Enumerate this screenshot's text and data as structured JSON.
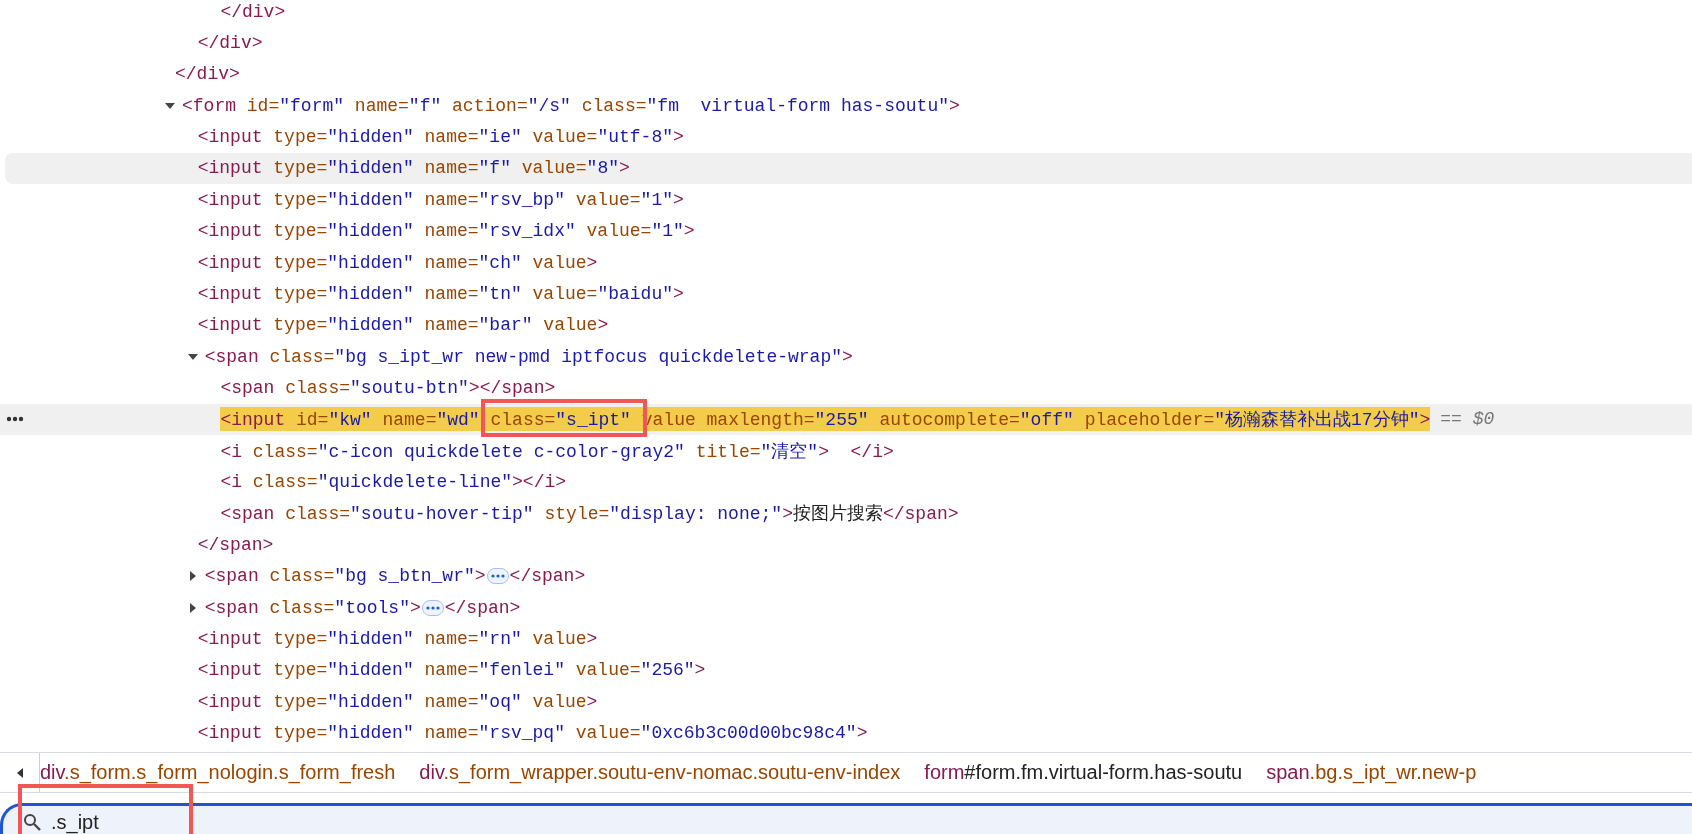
{
  "dom_tree": [
    {
      "selected": false,
      "hovered": false,
      "close": [
        {
          "kind": "tag",
          "text": "</div>"
        }
      ],
      "children": [
        {
          "selected": false,
          "hovered": false,
          "close": [
            {
              "kind": "tag",
              "text": "</div>"
            }
          ],
          "children": [
            {
              "selected": false,
              "hovered": false,
              "close": [
                {
                  "kind": "tag",
                  "text": "</div>"
                }
              ]
            }
          ]
        }
      ]
    },
    {
      "selected": false,
      "hovered": false,
      "expanded": true,
      "open": [
        {
          "kind": "tag",
          "text": "<form"
        },
        {
          "kind": "attr",
          "text": " id="
        },
        {
          "kind": "value",
          "text": "\"form\""
        },
        {
          "kind": "attr",
          "text": " name="
        },
        {
          "kind": "value",
          "text": "\"f\""
        },
        {
          "kind": "attr",
          "text": " action="
        },
        {
          "kind": "value",
          "text": "\"/s\""
        },
        {
          "kind": "attr",
          "text": " class="
        },
        {
          "kind": "value",
          "text": "\"fm  virtual-form has-soutu\""
        },
        {
          "kind": "tag",
          "text": ">"
        }
      ],
      "children": [
        {
          "selected": false,
          "hovered": false,
          "open": [
            {
              "kind": "tag",
              "text": "<input"
            },
            {
              "kind": "attr",
              "text": " type="
            },
            {
              "kind": "value",
              "text": "\"hidden\""
            },
            {
              "kind": "attr",
              "text": " name="
            },
            {
              "kind": "value",
              "text": "\"ie\""
            },
            {
              "kind": "attr",
              "text": " value="
            },
            {
              "kind": "value",
              "text": "\"utf-8\""
            },
            {
              "kind": "tag",
              "text": ">"
            }
          ]
        },
        {
          "selected": false,
          "hovered": true,
          "open": [
            {
              "kind": "tag",
              "text": "<input"
            },
            {
              "kind": "attr",
              "text": " type="
            },
            {
              "kind": "value",
              "text": "\"hidden\""
            },
            {
              "kind": "attr",
              "text": " name="
            },
            {
              "kind": "value",
              "text": "\"f\""
            },
            {
              "kind": "attr",
              "text": " value="
            },
            {
              "kind": "value",
              "text": "\"8\""
            },
            {
              "kind": "tag",
              "text": ">"
            }
          ]
        },
        {
          "selected": false,
          "hovered": false,
          "open": [
            {
              "kind": "tag",
              "text": "<input"
            },
            {
              "kind": "attr",
              "text": " type="
            },
            {
              "kind": "value",
              "text": "\"hidden\""
            },
            {
              "kind": "attr",
              "text": " name="
            },
            {
              "kind": "value",
              "text": "\"rsv_bp\""
            },
            {
              "kind": "attr",
              "text": " value="
            },
            {
              "kind": "value",
              "text": "\"1\""
            },
            {
              "kind": "tag",
              "text": ">"
            }
          ]
        },
        {
          "selected": false,
          "hovered": false,
          "open": [
            {
              "kind": "tag",
              "text": "<input"
            },
            {
              "kind": "attr",
              "text": " type="
            },
            {
              "kind": "value",
              "text": "\"hidden\""
            },
            {
              "kind": "attr",
              "text": " name="
            },
            {
              "kind": "value",
              "text": "\"rsv_idx\""
            },
            {
              "kind": "attr",
              "text": " value="
            },
            {
              "kind": "value",
              "text": "\"1\""
            },
            {
              "kind": "tag",
              "text": ">"
            }
          ]
        },
        {
          "selected": false,
          "hovered": false,
          "open": [
            {
              "kind": "tag",
              "text": "<input"
            },
            {
              "kind": "attr",
              "text": " type="
            },
            {
              "kind": "value",
              "text": "\"hidden\""
            },
            {
              "kind": "attr",
              "text": " name="
            },
            {
              "kind": "value",
              "text": "\"ch\""
            },
            {
              "kind": "attr",
              "text": " value"
            },
            {
              "kind": "tag",
              "text": ">"
            }
          ]
        },
        {
          "selected": false,
          "hovered": false,
          "open": [
            {
              "kind": "tag",
              "text": "<input"
            },
            {
              "kind": "attr",
              "text": " type="
            },
            {
              "kind": "value",
              "text": "\"hidden\""
            },
            {
              "kind": "attr",
              "text": " name="
            },
            {
              "kind": "value",
              "text": "\"tn\""
            },
            {
              "kind": "attr",
              "text": " value="
            },
            {
              "kind": "value",
              "text": "\"baidu\""
            },
            {
              "kind": "tag",
              "text": ">"
            }
          ]
        },
        {
          "selected": false,
          "hovered": false,
          "open": [
            {
              "kind": "tag",
              "text": "<input"
            },
            {
              "kind": "attr",
              "text": " type="
            },
            {
              "kind": "value",
              "text": "\"hidden\""
            },
            {
              "kind": "attr",
              "text": " name="
            },
            {
              "kind": "value",
              "text": "\"bar\""
            },
            {
              "kind": "attr",
              "text": " value"
            },
            {
              "kind": "tag",
              "text": ">"
            }
          ]
        },
        {
          "selected": false,
          "hovered": false,
          "expanded": true,
          "open": [
            {
              "kind": "tag",
              "text": "<span"
            },
            {
              "kind": "attr",
              "text": " class="
            },
            {
              "kind": "value",
              "text": "\"bg s_ipt_wr new-pmd iptfocus quickdelete-wrap\""
            },
            {
              "kind": "tag",
              "text": ">"
            }
          ],
          "close": [
            {
              "kind": "tag",
              "text": "</span>"
            }
          ],
          "children": [
            {
              "selected": false,
              "hovered": false,
              "open": [
                {
                  "kind": "tag",
                  "text": "<span"
                },
                {
                  "kind": "attr",
                  "text": " class="
                },
                {
                  "kind": "value",
                  "text": "\"soutu-btn\""
                },
                {
                  "kind": "tag",
                  "text": "></span>"
                }
              ]
            },
            {
              "selected": true,
              "hovered": false,
              "console_ref": "== $0",
              "open": [
                {
                  "kind": "tag",
                  "text": "<input"
                },
                {
                  "kind": "attr",
                  "text": " id="
                },
                {
                  "kind": "value",
                  "text": "\"kw\""
                },
                {
                  "kind": "attr",
                  "text": " name="
                },
                {
                  "kind": "value",
                  "text": "\"wd\""
                },
                {
                  "kind": "attr",
                  "text": " class="
                },
                {
                  "kind": "value",
                  "text": "\"s_ipt\""
                },
                {
                  "kind": "attr",
                  "text": " value maxlength="
                },
                {
                  "kind": "value",
                  "text": "\"255\""
                },
                {
                  "kind": "attr",
                  "text": " autocomplete="
                },
                {
                  "kind": "value",
                  "text": "\"off\""
                },
                {
                  "kind": "attr",
                  "text": " placeholder="
                },
                {
                  "kind": "value",
                  "text": "\"杨瀚森替补出战17分钟\""
                },
                {
                  "kind": "tag",
                  "text": ">"
                }
              ]
            },
            {
              "selected": false,
              "hovered": false,
              "open": [
                {
                  "kind": "tag",
                  "text": "<i"
                },
                {
                  "kind": "attr",
                  "text": " class="
                },
                {
                  "kind": "value",
                  "text": "\"c-icon quickdelete c-color-gray2\""
                },
                {
                  "kind": "attr",
                  "text": " title="
                },
                {
                  "kind": "value",
                  "text": "\"清空\""
                },
                {
                  "kind": "tag",
                  "text": ">  </i>"
                }
              ]
            },
            {
              "selected": false,
              "hovered": false,
              "open": [
                {
                  "kind": "tag",
                  "text": "<i"
                },
                {
                  "kind": "attr",
                  "text": " class="
                },
                {
                  "kind": "value",
                  "text": "\"quickdelete-line\""
                },
                {
                  "kind": "tag",
                  "text": "></i>"
                }
              ]
            },
            {
              "selected": false,
              "hovered": false,
              "open": [
                {
                  "kind": "tag",
                  "text": "<span"
                },
                {
                  "kind": "attr",
                  "text": " class="
                },
                {
                  "kind": "value",
                  "text": "\"soutu-hover-tip\""
                },
                {
                  "kind": "attr",
                  "text": " style="
                },
                {
                  "kind": "value",
                  "text": "\"display: none;\""
                },
                {
                  "kind": "tag",
                  "text": ">"
                },
                {
                  "kind": "text",
                  "text": "按图片搜索"
                },
                {
                  "kind": "tag",
                  "text": "</span>"
                }
              ]
            }
          ]
        },
        {
          "selected": false,
          "hovered": false,
          "expanded": false,
          "open": [
            {
              "kind": "tag",
              "text": "<span"
            },
            {
              "kind": "attr",
              "text": " class="
            },
            {
              "kind": "value",
              "text": "\"bg s_btn_wr\""
            },
            {
              "kind": "tag",
              "text": ">"
            }
          ],
          "close": [
            {
              "kind": "tag",
              "text": "</span>"
            }
          ]
        },
        {
          "selected": false,
          "hovered": false,
          "expanded": false,
          "open": [
            {
              "kind": "tag",
              "text": "<span"
            },
            {
              "kind": "attr",
              "text": " class="
            },
            {
              "kind": "value",
              "text": "\"tools\""
            },
            {
              "kind": "tag",
              "text": ">"
            }
          ],
          "close": [
            {
              "kind": "tag",
              "text": "</span>"
            }
          ]
        },
        {
          "selected": false,
          "hovered": false,
          "open": [
            {
              "kind": "tag",
              "text": "<input"
            },
            {
              "kind": "attr",
              "text": " type="
            },
            {
              "kind": "value",
              "text": "\"hidden\""
            },
            {
              "kind": "attr",
              "text": " name="
            },
            {
              "kind": "value",
              "text": "\"rn\""
            },
            {
              "kind": "attr",
              "text": " value"
            },
            {
              "kind": "tag",
              "text": ">"
            }
          ]
        },
        {
          "selected": false,
          "hovered": false,
          "open": [
            {
              "kind": "tag",
              "text": "<input"
            },
            {
              "kind": "attr",
              "text": " type="
            },
            {
              "kind": "value",
              "text": "\"hidden\""
            },
            {
              "kind": "attr",
              "text": " name="
            },
            {
              "kind": "value",
              "text": "\"fenlei\""
            },
            {
              "kind": "attr",
              "text": " value="
            },
            {
              "kind": "value",
              "text": "\"256\""
            },
            {
              "kind": "tag",
              "text": ">"
            }
          ]
        },
        {
          "selected": false,
          "hovered": false,
          "open": [
            {
              "kind": "tag",
              "text": "<input"
            },
            {
              "kind": "attr",
              "text": " type="
            },
            {
              "kind": "value",
              "text": "\"hidden\""
            },
            {
              "kind": "attr",
              "text": " name="
            },
            {
              "kind": "value",
              "text": "\"oq\""
            },
            {
              "kind": "attr",
              "text": " value"
            },
            {
              "kind": "tag",
              "text": ">"
            }
          ]
        },
        {
          "selected": false,
          "hovered": false,
          "open": [
            {
              "kind": "tag",
              "text": "<input"
            },
            {
              "kind": "attr",
              "text": " type="
            },
            {
              "kind": "value",
              "text": "\"hidden\""
            },
            {
              "kind": "attr",
              "text": " name="
            },
            {
              "kind": "value",
              "text": "\"rsv_pq\""
            },
            {
              "kind": "attr",
              "text": " value="
            },
            {
              "kind": "value",
              "text": "\"0xc6b3c00d00bc98c4\""
            },
            {
              "kind": "tag",
              "text": ">"
            }
          ]
        }
      ]
    }
  ],
  "breadcrumbs": [
    {
      "tag": "div",
      "selector": ".s_form.s_form_nologin.s_form_fresh",
      "hovered": false
    },
    {
      "tag": "div",
      "selector": ".s_form_wrapper.soutu-env-nomac.soutu-env-index",
      "hovered": false
    },
    {
      "tag": "form",
      "selector": "#form.fm.virtual-form.has-soutu",
      "hovered": true
    },
    {
      "tag": "span",
      "selector": ".bg.s_ipt_wr.new-p",
      "hovered": false
    }
  ],
  "search": {
    "value": ".s_ipt"
  }
}
